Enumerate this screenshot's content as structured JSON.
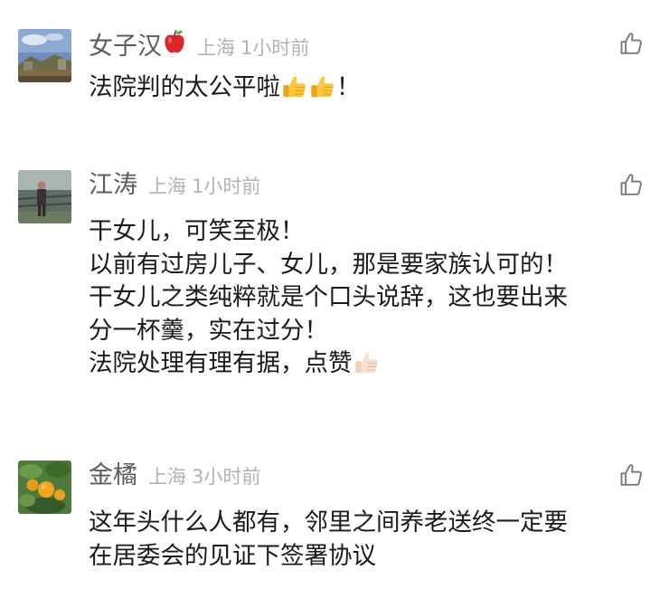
{
  "comments": [
    {
      "username": "女子汉",
      "name_emoji": "apple-emoji",
      "location": "上海",
      "time": "1小时前",
      "lines": [
        {
          "text": "法院判的太公平啦",
          "suffix": "！",
          "emoji": [
            "thumbs-up-emoji",
            "thumbs-up-emoji"
          ]
        }
      ]
    },
    {
      "username": "江涛",
      "location": "上海",
      "time": "1小时前",
      "lines": [
        {
          "text": "干女儿，可笑至极！"
        },
        {
          "text": "以前有过房儿子、女儿，那是要家族认可的！"
        },
        {
          "text": "干女儿之类纯粹就是个口头说辞，这也要出来"
        },
        {
          "text": "分一杯羹，实在过分！"
        },
        {
          "text": "法院处理有理有据，点赞",
          "emoji": [
            "light-thumbs-up-emoji"
          ]
        }
      ]
    },
    {
      "username": "金橘",
      "location": "上海",
      "time": "3小时前",
      "lines": [
        {
          "text": "这年头什么人都有，邻里之间养老送终一定要"
        },
        {
          "text": "在居委会的见证下签署协议"
        }
      ]
    }
  ],
  "colors": {
    "username": "#5c5c5c",
    "meta": "#b3b3b3",
    "body": "#1a1a1a",
    "like_icon": "#7a7a7a",
    "background": "#ffffff"
  }
}
